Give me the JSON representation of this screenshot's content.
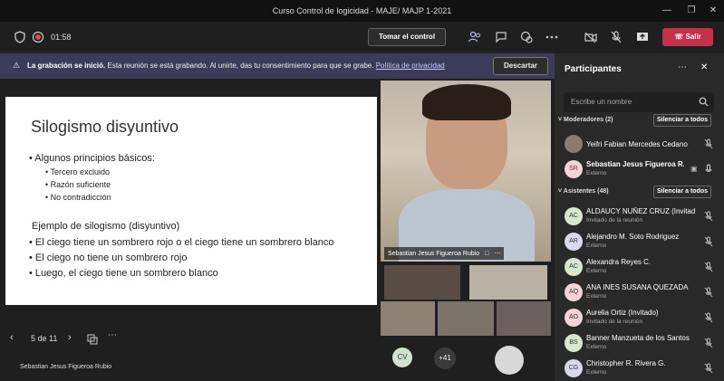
{
  "window": {
    "title": "Curso Control de logicidad - MAJE/ MAJP 1-2021"
  },
  "toolbar": {
    "timer": "01:58",
    "take_control": "Tomar el control",
    "leave": "Salir"
  },
  "banner": {
    "bold": "La grabación se inició.",
    "text": "Esta reunión se está grabando. Al unirte, das tu consentimiento para que se grabe.",
    "link": "Política de privacidad",
    "dismiss": "Descartar"
  },
  "slide": {
    "title": "Silogismo disyuntivo",
    "bullet1": "• Algunos principios básicos:",
    "sub1": "• Tercero excluido",
    "sub2": "• Razón suficiente",
    "sub3": "• No contradicción",
    "example": "Ejemplo de silogismo (disyuntivo)",
    "b2": "• El ciego tiene un sombrero rojo o el ciego tiene un sombrero blanco",
    "b3": "• El ciego no tiene un sombrero rojo",
    "b4": "• Luego, el ciego tiene un sombrero blanco"
  },
  "slide_nav": {
    "page": "5 de 11",
    "presenter": "Sebastian Jesus Figueroa Rubio"
  },
  "video": {
    "main_label": "Sebastian Jesus Figueroa Rubio",
    "cv_initials": "CV",
    "more_count": "+41"
  },
  "panel": {
    "title": "Participantes",
    "search_placeholder": "Escribe un nombre",
    "moderators_header": "Moderadores (2)",
    "attendees_header": "Asistentes (48)",
    "silence_all": "Silenciar a todos",
    "moderators": [
      {
        "initials": "",
        "name": "Yeifri Fabian Mercedes Cedano",
        "sub": ""
      },
      {
        "initials": "SR",
        "name": "Sebastian Jesus Figueroa R...",
        "sub": "Externo"
      }
    ],
    "attendees": [
      {
        "initials": "AC",
        "name": "ALDAUCY NUÑEZ CRUZ (Invitado)",
        "sub": "Invitado de la reunión"
      },
      {
        "initials": "AR",
        "name": "Alejandro M. Soto Rodriguez",
        "sub": "Externo"
      },
      {
        "initials": "AC",
        "name": "Alexandra Reyes C.",
        "sub": "Externo"
      },
      {
        "initials": "AQ",
        "name": "ANA INES SUSANA QUEZADA",
        "sub": "Externo"
      },
      {
        "initials": "AO",
        "name": "Aurelia Ortiz (Invitado)",
        "sub": "Invitado de la reunión"
      },
      {
        "initials": "BS",
        "name": "Banner Manzueta de los Santos",
        "sub": "Externo"
      },
      {
        "initials": "CG",
        "name": "Christopher R. Rivera G.",
        "sub": "Externo"
      }
    ]
  }
}
